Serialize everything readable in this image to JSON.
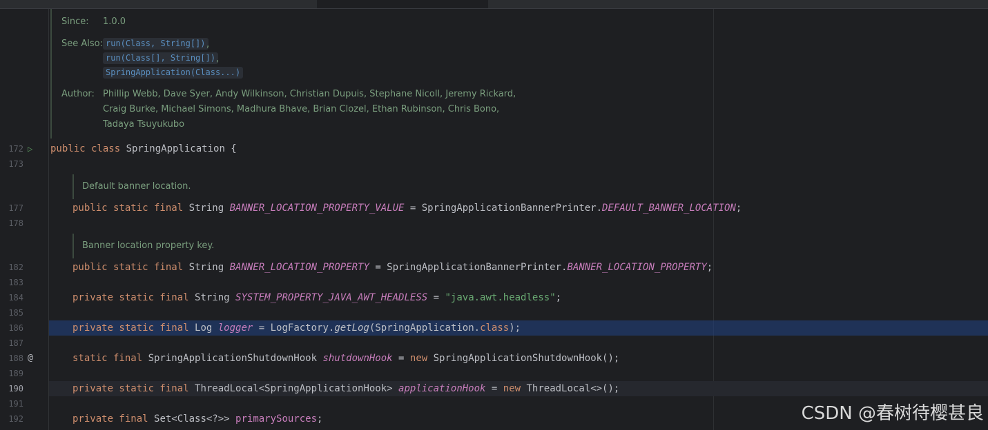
{
  "tabs": [
    {
      "label": ""
    },
    {
      "label": ""
    },
    {
      "label": ""
    }
  ],
  "gutter": {
    "line_numbers": [
      "172",
      "173",
      "177",
      "178",
      "182",
      "183",
      "184",
      "185",
      "186",
      "187",
      "188",
      "189",
      "190",
      "191",
      "192"
    ],
    "run_icon": "run-gutter-icon",
    "override_icon": "at-annotation-icon",
    "run_glyph": "▷",
    "at_glyph": "@"
  },
  "javadoc_class": {
    "since_label": "Since:",
    "since_value": "1.0.0",
    "see_also_label": "See Also:",
    "see_also_links": [
      "run(Class, String[])",
      "run(Class[], String[])",
      "SpringApplication(Class...)"
    ],
    "comma": ",",
    "author_label": "Author:",
    "author_lines": [
      "Phillip Webb, Dave Syer, Andy Wilkinson, Christian Dupuis, Stephane Nicoll, Jeremy Rickard,",
      "Craig Burke, Michael Simons, Madhura Bhave, Brian Clozel, Ethan Rubinson, Chris Bono,",
      "Tadaya Tsuyukubo"
    ]
  },
  "code": {
    "l172": {
      "kw": "public class ",
      "rest": "SpringApplication {"
    },
    "doc_banner_value": "Default banner location.",
    "l177": {
      "kw": "public static final ",
      "type": "String ",
      "name": "BANNER_LOCATION_PROPERTY_VALUE",
      "eq": " = SpringApplicationBannerPrinter.",
      "ref": "DEFAULT_BANNER_LOCATION",
      "end": ";"
    },
    "doc_banner_key": "Banner location property key.",
    "l182": {
      "kw": "public static final ",
      "type": "String ",
      "name": "BANNER_LOCATION_PROPERTY",
      "eq": " = SpringApplicationBannerPrinter.",
      "ref": "BANNER_LOCATION_PROPERTY",
      "end": ";"
    },
    "l184": {
      "kw": "private static final ",
      "type": "String ",
      "name": "SYSTEM_PROPERTY_JAVA_AWT_HEADLESS",
      "eq": " = ",
      "str": "\"java.awt.headless\"",
      "end": ";"
    },
    "l186": {
      "kw": "private static final ",
      "type": "Log ",
      "name": "logger",
      "eq": " = LogFactory.",
      "method": "getLog",
      "args": "(SpringApplication.",
      "kw2": "class",
      "end": ");"
    },
    "l188": {
      "kw": "static final ",
      "type": "SpringApplicationShutdownHook ",
      "name": "shutdownHook",
      "eq": " = ",
      "kw2": "new ",
      "rest": "SpringApplicationShutdownHook();"
    },
    "l190": {
      "kw": "private static final ",
      "type": "ThreadLocal<SpringApplicationHook> ",
      "name": "applicationHook",
      "eq": " = ",
      "kw2": "new ",
      "rest": "ThreadLocal<>();"
    },
    "l192": {
      "kw": "private final ",
      "type": "Set<Class<?>> ",
      "name": "primarySources",
      "end": ";"
    }
  },
  "watermark": "CSDN @春树待樱甚良"
}
